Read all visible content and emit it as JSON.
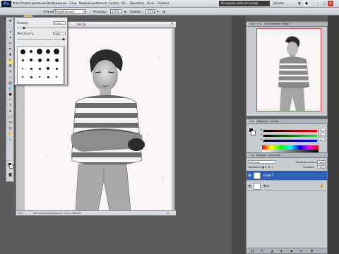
{
  "app": {
    "logo": "Ps",
    "workspace_label": "Основная рабочая среда",
    "design_label": "Дизайн"
  },
  "menubar": {
    "items": [
      "Файл",
      "Редактирование",
      "Изображение",
      "Слои",
      "Выделение",
      "Фильтр",
      "Анализ",
      "3D",
      "Просмотр",
      "Окно",
      "Справка"
    ]
  },
  "options": {
    "mode_label": "Режим:",
    "mode_value": "Нормальный",
    "opacity_label": "Непрозр.:",
    "opacity_value": "100%",
    "flow_label": "Нажим:",
    "flow_value": "100%"
  },
  "brush_popup": {
    "size_label": "Размер:",
    "size_value": "9 пикс.",
    "hardness_label": "Жесткость:",
    "hardness_value": "100%"
  },
  "document": {
    "tab_label": "без @",
    "zoom": "50%",
    "status_label": "Экспонирование работает только в 32-бит"
  },
  "panels": {
    "navigator_tab": "Навигатор",
    "histogram_tab": "Гистограмма",
    "info_tab": "Инфо",
    "color_tab": "Цвет",
    "swatches_tab": "Образцы",
    "styles_tab": "Стили",
    "color_values": {
      "R": "0",
      "G": "0",
      "B": "0"
    },
    "layers_tab": "Слои",
    "channels_tab": "Каналы",
    "paths_tab": "Контуры",
    "blend_mode": "Обычные",
    "opacity_label": "Непрозрачность:",
    "opacity_value": "100%",
    "lock_label": "Закрепить:",
    "fill_label": "Заливка:",
    "fill_value": "100%",
    "layers": [
      {
        "name": "Слой 1",
        "selected": true
      },
      {
        "name": "Фон",
        "selected": false
      }
    ]
  },
  "colors": {
    "accent_blue": "#2f62b5",
    "selection_yellow": "#f1c84a",
    "nav_frame_red": "#d84848"
  }
}
